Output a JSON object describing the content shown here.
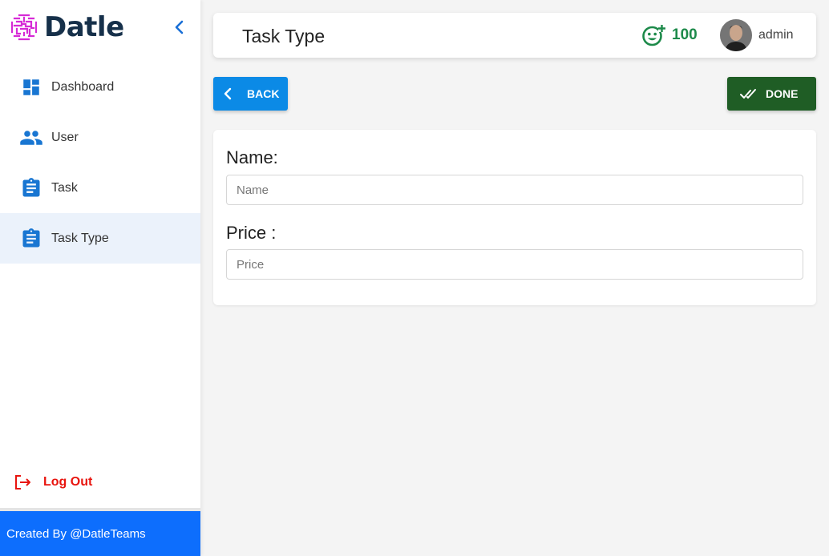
{
  "sidebar": {
    "brand": "Datle",
    "items": [
      {
        "label": "Dashboard",
        "icon": "dashboard-icon",
        "active": false
      },
      {
        "label": "User",
        "icon": "users-icon",
        "active": false
      },
      {
        "label": "Task",
        "icon": "clipboard-icon",
        "active": false
      },
      {
        "label": "Task Type",
        "icon": "clipboard-icon",
        "active": true
      }
    ],
    "logout_label": "Log Out",
    "footer_text": "Created By @DatleTeams"
  },
  "header": {
    "title": "Task Type",
    "points": "100",
    "username": "admin"
  },
  "actions": {
    "back_label": "BACK",
    "done_label": "DONE"
  },
  "form": {
    "name_label": "Name:",
    "name_placeholder": "Name",
    "name_value": "",
    "price_label": "Price :",
    "price_placeholder": "Price",
    "price_value": ""
  },
  "colors": {
    "accent_blue": "#0b8ae6",
    "done_green": "#1f5d25",
    "points_green": "#1d8a4a",
    "logout_red": "#e8140e",
    "footer_blue": "#0d6efd",
    "brand_magenta": "#d62bd6",
    "brand_navy": "#16304a"
  }
}
